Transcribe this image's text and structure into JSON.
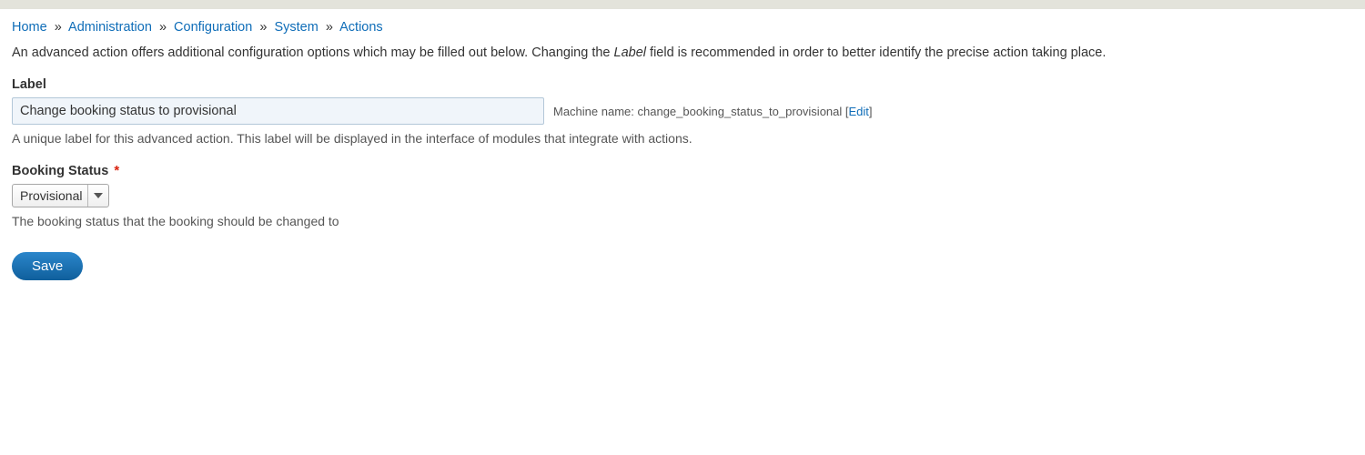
{
  "breadcrumb": {
    "items": [
      {
        "label": "Home"
      },
      {
        "label": "Administration"
      },
      {
        "label": "Configuration"
      },
      {
        "label": "System"
      },
      {
        "label": "Actions"
      }
    ],
    "separator": "»"
  },
  "intro": {
    "prefix": "An advanced action offers additional configuration options which may be filled out below. Changing the ",
    "italic": "Label",
    "suffix": " field is recommended in order to better identify the precise action taking place."
  },
  "label": {
    "title": "Label",
    "value": "Change booking status to provisional",
    "machine_name_prefix": "Machine name: ",
    "machine_name_value": "change_booking_status_to_provisional",
    "edit_open": " [",
    "edit_link": "Edit",
    "edit_close": "]",
    "description": "A unique label for this advanced action. This label will be displayed in the interface of modules that integrate with actions."
  },
  "booking_status": {
    "title": "Booking Status",
    "required_mark": "*",
    "selected": "Provisional",
    "description": "The booking status that the booking should be changed to"
  },
  "actions": {
    "save_label": "Save"
  }
}
